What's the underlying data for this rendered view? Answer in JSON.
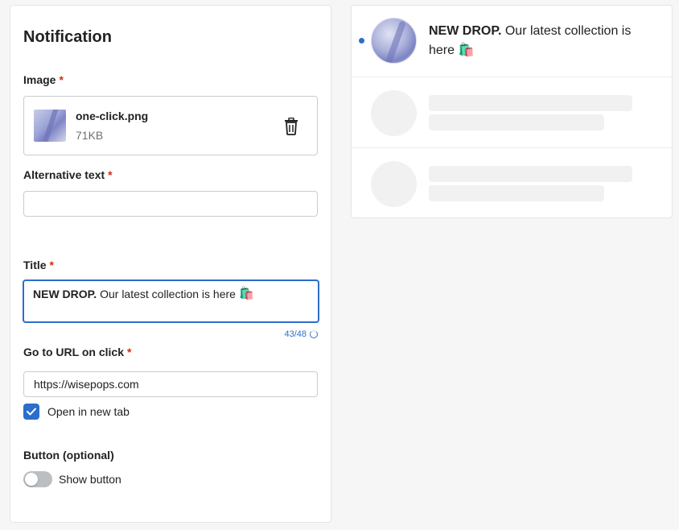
{
  "panel": {
    "title": "Notification",
    "image_label": "Image",
    "required_mark": "*",
    "file": {
      "name": "one-click.png",
      "size": "71KB"
    },
    "alt_text_label": "Alternative text",
    "alt_text_value": "",
    "title_label": "Title",
    "title_value_bold": "NEW DROP.",
    "title_value_rest": "Our latest collection is here",
    "emoji": "🛍️",
    "char_counter": "43/48",
    "url_label": "Go to URL on click",
    "url_value": "https://wisepops.com",
    "open_new_tab_label": "Open in new tab",
    "open_new_tab_checked": true,
    "button_section_label": "Button (optional)",
    "show_button_label": "Show button",
    "show_button_on": false
  },
  "preview": {
    "title_bold": "NEW DROP.",
    "title_rest": "Our latest collection is here",
    "emoji": "🛍️",
    "unread": true
  },
  "colors": {
    "accent": "#2c6ecb",
    "required": "#d72c0d",
    "placeholder": "#f1f1f1"
  },
  "icons": [
    "trash-icon",
    "check-icon",
    "progress-ring-icon",
    "unread-dot"
  ]
}
